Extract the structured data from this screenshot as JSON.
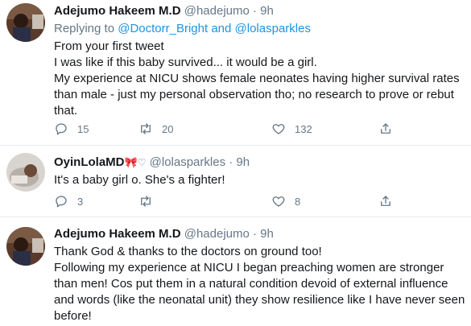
{
  "tweets": [
    {
      "name": "Adejumo Hakeem M.D",
      "handle": "@hadejumo",
      "dot": "·",
      "time": "9h",
      "reply_prefix": "Replying to",
      "reply_user1": "@Doctorr_Bright",
      "reply_and": "and",
      "reply_user2": "@lolasparkles",
      "lines": [
        "From your first tweet",
        "I was like if this baby survived... it would be a girl.",
        "My experience at NICU shows female neonates having higher survival rates",
        "than male - just my personal observation tho; no research to prove or rebut",
        "that."
      ],
      "replies": "15",
      "retweets": "20",
      "likes": "132"
    },
    {
      "name": "OyinLolaMD",
      "name_emoji": "🎀",
      "name_heart": "♡",
      "handle": "@lolasparkles",
      "dot": "·",
      "time": "9h",
      "lines": [
        "It's a baby girl o. She's a fighter!"
      ],
      "replies": "3",
      "likes": "8"
    },
    {
      "name": "Adejumo Hakeem M.D",
      "handle": "@hadejumo",
      "dot": "·",
      "time": "9h",
      "lines": [
        "Thank God & thanks to the doctors on ground too!",
        "Following my experience at NICU I began preaching women are stronger",
        "than men! Cos put them in a natural condition devoid of external influence",
        "and words (like the neonatal unit) they show resilience like I have never seen",
        "before!"
      ]
    }
  ],
  "colors": {
    "link": "#1b95e0",
    "muted": "#657786",
    "text": "#14171a",
    "divider": "#e6ecf0"
  },
  "icons": {
    "reply": "reply-icon",
    "retweet": "retweet-icon",
    "like": "heart-icon",
    "share": "share-icon"
  }
}
